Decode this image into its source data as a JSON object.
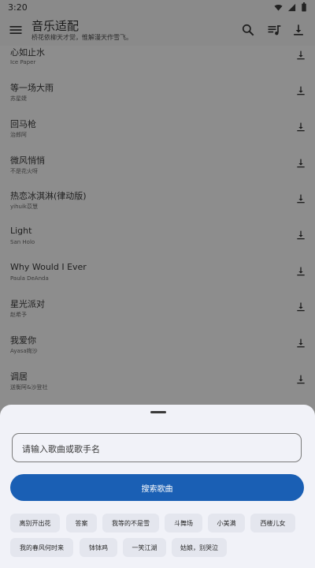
{
  "status": {
    "time": "3:20"
  },
  "appbar": {
    "title": "音乐适配",
    "subtitle": "桥花依柳天才觉，惟解漫天作雪飞。"
  },
  "songs": [
    {
      "title": "心如止水",
      "artist": "Ice Paper"
    },
    {
      "title": "等一场大雨",
      "artist": "苏星婕"
    },
    {
      "title": "回马枪",
      "artist": "治郎阿"
    },
    {
      "title": "微风悄悄",
      "artist": "不是花火呀"
    },
    {
      "title": "热恋冰淇淋(律动版)",
      "artist": "yihuik苡慧"
    },
    {
      "title": "Light",
      "artist": "San Holo"
    },
    {
      "title": "Why Would I Ever",
      "artist": "Paula DeAnda"
    },
    {
      "title": "星光派对",
      "artist": "赵希予"
    },
    {
      "title": "我爱你",
      "artist": "Ayasa绚沙"
    },
    {
      "title": "调居",
      "artist": "送衡阿&沙登社"
    }
  ],
  "sheet": {
    "search_placeholder": "请输入歌曲或歌手名",
    "search_button": "搜索歌曲",
    "chips": [
      "离别开出花",
      "答案",
      "我等的不是雪",
      "斗舞场",
      "小美满",
      "西楼儿女",
      "我的春风何时来",
      "钵钵鸡",
      "一笑江湖",
      "姑娘，别哭泣"
    ]
  },
  "colors": {
    "accent": "#1a5fb4",
    "scrim": "#8d8d8d",
    "sheet": "#f1f2f8"
  },
  "icons": {
    "menu": "menu-icon",
    "search": "search-icon",
    "queue": "queue-music-icon",
    "download": "download-icon"
  }
}
